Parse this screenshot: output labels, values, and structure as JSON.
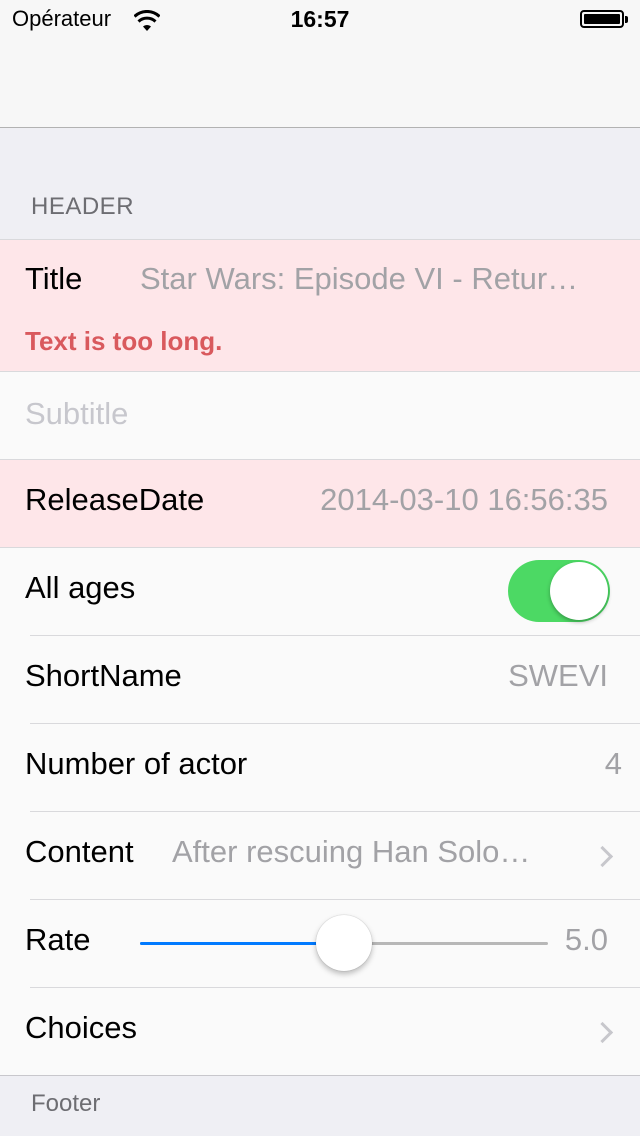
{
  "status_bar": {
    "carrier": "Opérateur",
    "time": "16:57"
  },
  "section": {
    "header": "HEADER",
    "footer": "Footer"
  },
  "rows": {
    "title": {
      "label": "Title",
      "value": "Star Wars: Episode VI - Retur…",
      "error": "Text is too long."
    },
    "subtitle": {
      "placeholder": "Subtitle"
    },
    "release_date": {
      "label": "ReleaseDate",
      "value": "2014-03-10 16:56:35"
    },
    "all_ages": {
      "label": "All ages",
      "on": true
    },
    "short_name": {
      "label": "ShortName",
      "value": "SWEVI"
    },
    "number_of_actor": {
      "label": "Number of actor",
      "value": "4"
    },
    "content": {
      "label": "Content",
      "value": "After rescuing Han Solo…"
    },
    "rate": {
      "label": "Rate",
      "value": "5.0",
      "min": 0,
      "max": 10,
      "current": 5.0
    },
    "choices": {
      "label": "Choices"
    }
  },
  "colors": {
    "error_background": "#fee6e9",
    "error_text": "#d9595d",
    "switch_on": "#4cd964",
    "slider_tint": "#007aff"
  },
  "icons": {
    "wifi": "wifi-icon",
    "battery": "battery-icon",
    "disclosure": "chevron-right-icon"
  }
}
